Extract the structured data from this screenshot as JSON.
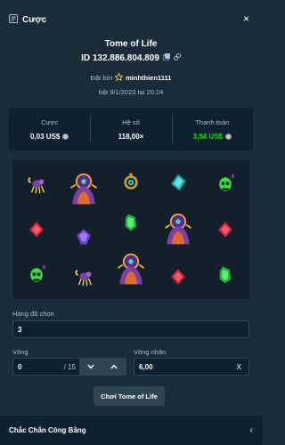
{
  "header": {
    "title": "Cược",
    "close": "×"
  },
  "bet": {
    "game_name": "Tome of Life",
    "id_text": "ID 132.886.804.809",
    "placed_by_label": "Đặt bởi",
    "username": "minhthien1111",
    "date_text": "bật 9/1/2023 tại 20:24"
  },
  "stats": [
    {
      "label": "Cược",
      "value": "0,03 US$",
      "coin": true,
      "color": "#ffffff"
    },
    {
      "label": "Hệ số",
      "value": "118,00×",
      "coin": false,
      "color": "#ffffff"
    },
    {
      "label": "Thanh toán",
      "value": "3,54 US$",
      "coin": true,
      "color": "#00e701"
    }
  ],
  "board": {
    "columns": [
      [
        "scorpion",
        "red-gem",
        "green-skull"
      ],
      [
        "wizard-wild",
        "purple-gem",
        "scorpion"
      ],
      [
        "eye-amulet",
        "green-gem",
        "wizard-wild"
      ],
      [
        "teal-gem",
        "wizard-wild",
        "red-gem"
      ],
      [
        "green-skull",
        "red-gem",
        "green-gem"
      ]
    ]
  },
  "form": {
    "lines_label": "Hàng đã chọn",
    "lines_value": "3",
    "spins_label": "Vòng",
    "spins_value": "0",
    "spins_total": "/ 15",
    "multiplier_label": "Vòng nhân",
    "multiplier_value": "6,00",
    "multiplier_suffix": "X"
  },
  "play_button": "Chơi Tome of Life",
  "footer": {
    "label": "Chắc Chắn Công Bằng",
    "chevron": "‹"
  },
  "colors": {
    "background": "#1a2c38",
    "panel": "#0f212e",
    "accent_green": "#00e701",
    "button": "#2f4553",
    "muted_text": "#b1bad3"
  }
}
